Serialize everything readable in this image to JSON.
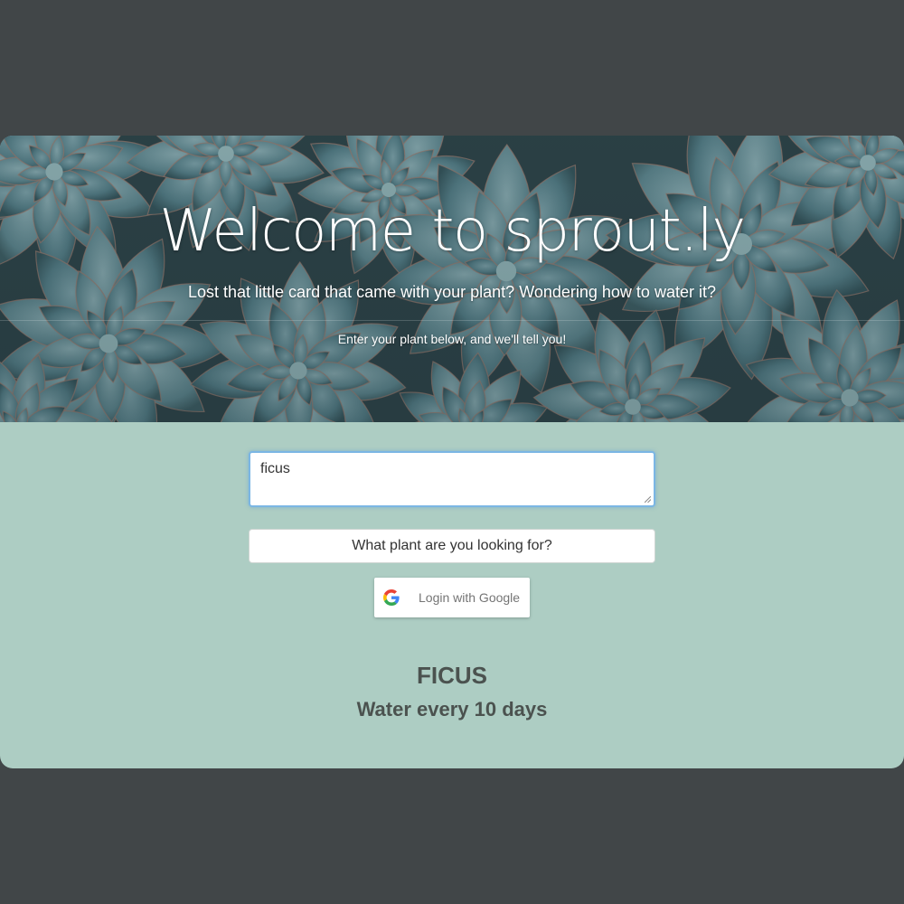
{
  "hero": {
    "title": "Welcome to sprout.ly",
    "subtitle": "Lost that little card that came with your plant? Wondering how to water it?",
    "hint": "Enter your plant below, and we'll tell you!"
  },
  "search": {
    "input_value": "ficus",
    "button_label": "What plant are you looking for?"
  },
  "auth": {
    "google_label": "Login with Google",
    "icon": "google-g-icon"
  },
  "result": {
    "plant_name": "FICUS",
    "watering": "Water every 10 days"
  },
  "colors": {
    "page_background": "#414648",
    "panel_background": "#adcdc3",
    "text_dark": "#4b524f",
    "input_focus_border": "#7bb6e4"
  }
}
